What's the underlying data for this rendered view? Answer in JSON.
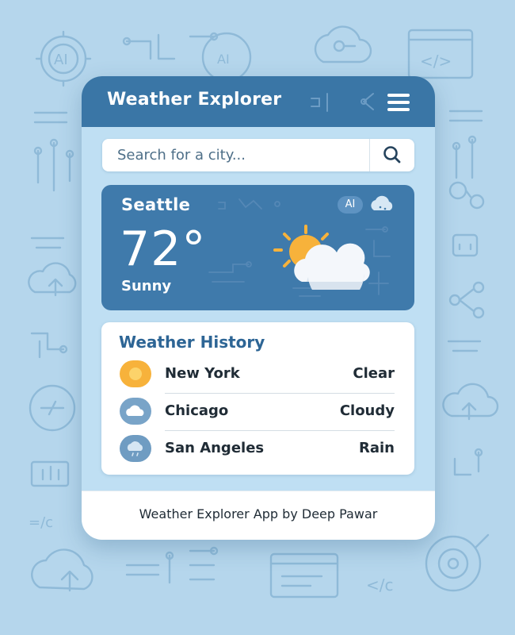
{
  "app": {
    "title": "Weather Explorer",
    "menu_icon": "hamburger-menu-icon"
  },
  "search": {
    "placeholder": "Search for a city...",
    "value": "",
    "button_icon": "search-icon"
  },
  "current": {
    "city": "Seattle",
    "temperature": "72°",
    "condition": "Sunny",
    "badge": "AI",
    "icon": "partly-sunny-icon"
  },
  "history": {
    "title": "Weather History",
    "items": [
      {
        "city": "New York",
        "condition": "Clear",
        "icon": "sun-icon"
      },
      {
        "city": "Chicago",
        "condition": "Cloudy",
        "icon": "cloud-icon"
      },
      {
        "city": "San Angeles",
        "condition": "Rain",
        "icon": "rain-icon"
      }
    ]
  },
  "footer": {
    "text": "Weather Explorer App by Deep Pawar"
  },
  "colors": {
    "header": "#3a76a6",
    "current_card": "#3f7aab",
    "background": "#b5d6ec",
    "history_title": "#2d6595",
    "sun": "#f7b23b"
  }
}
